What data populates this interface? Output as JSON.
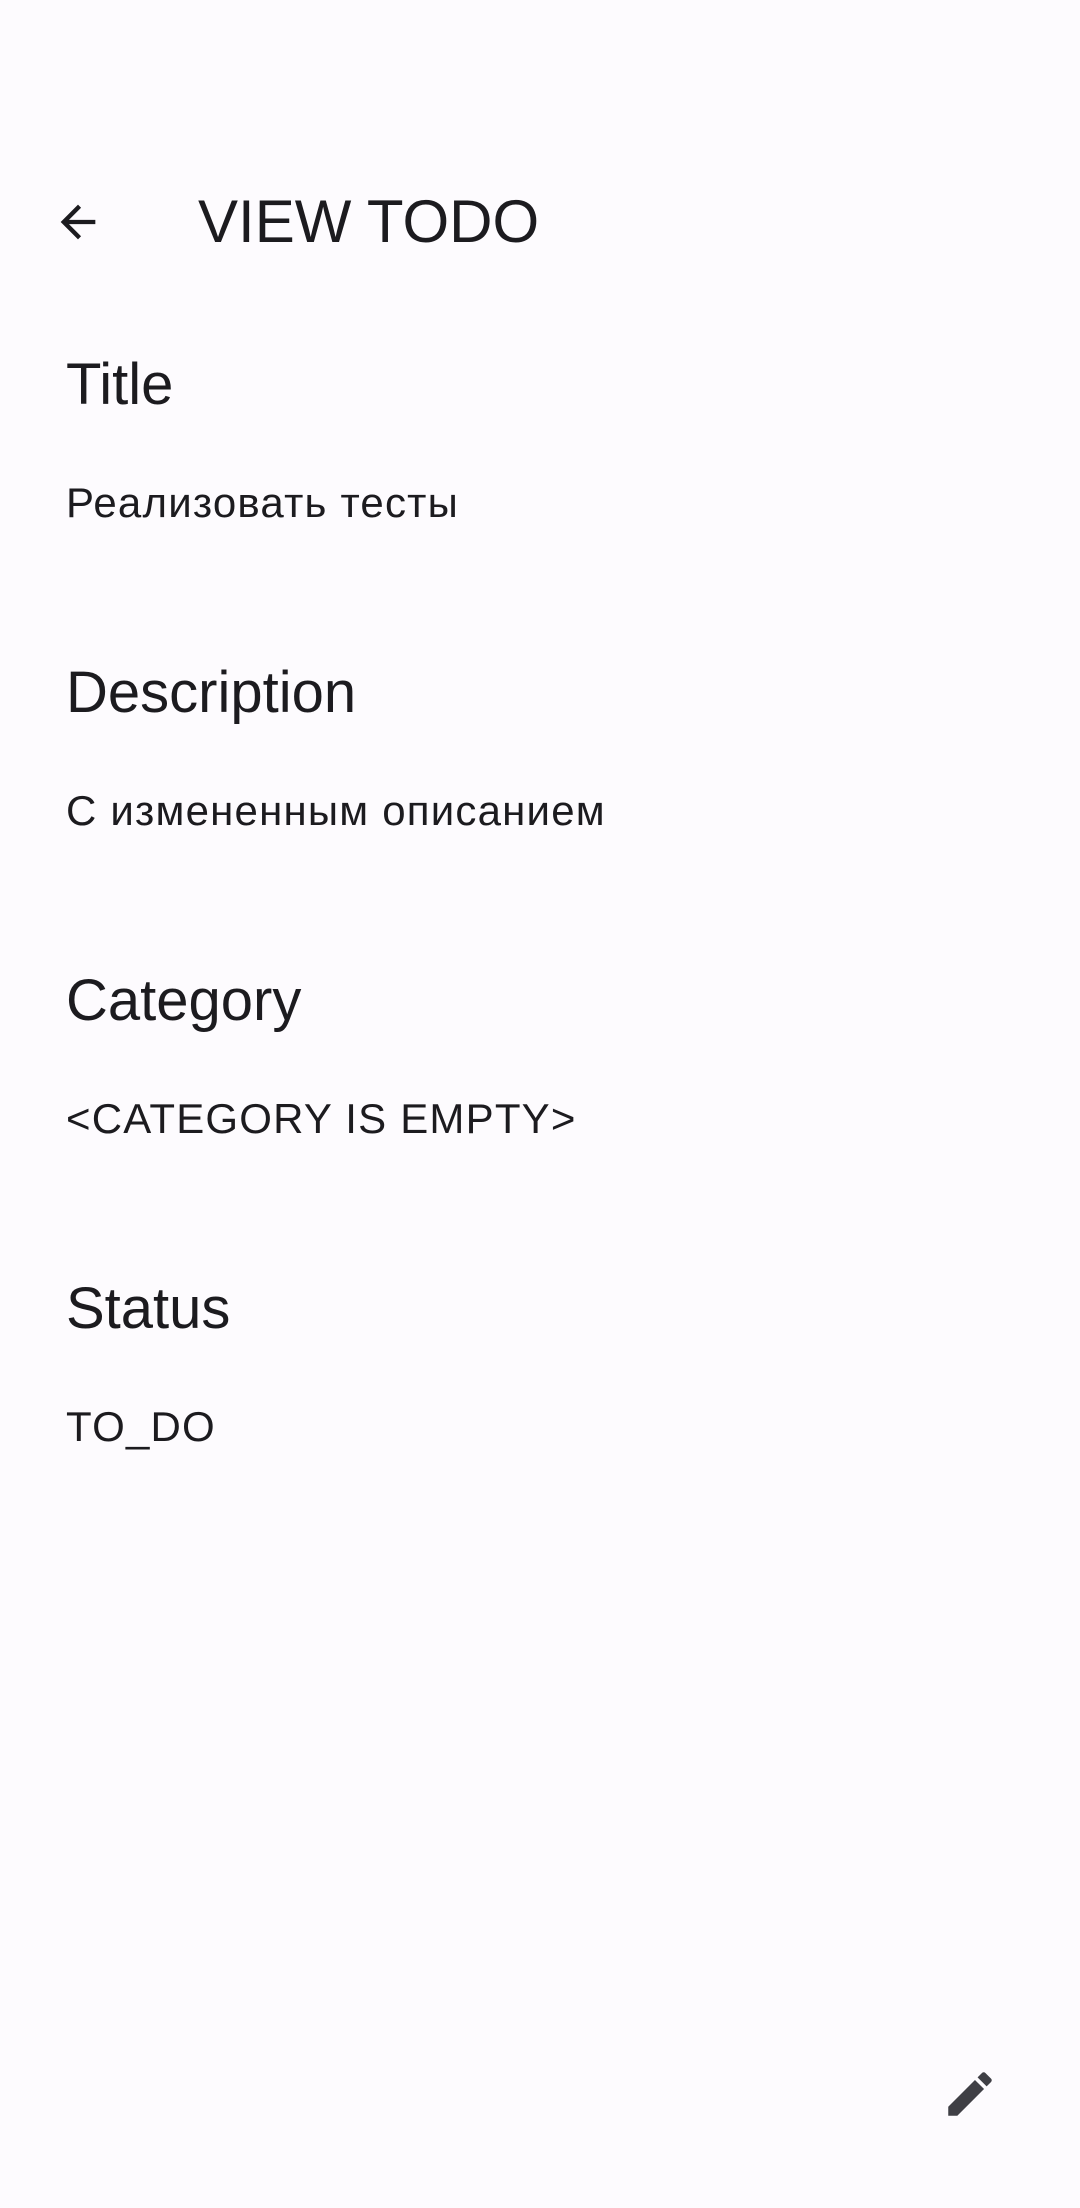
{
  "app_bar": {
    "title": "VIEW TODO",
    "back_icon": "arrow-back-icon"
  },
  "fields": [
    {
      "label": "Title",
      "value": "Реализовать тесты"
    },
    {
      "label": "Description",
      "value": "С измененным описанием"
    },
    {
      "label": "Category",
      "value": "<CATEGORY IS EMPTY>"
    },
    {
      "label": "Status",
      "value": "TO_DO"
    }
  ],
  "fab": {
    "icon": "edit-pencil-icon"
  },
  "colors": {
    "background": "#fdfbfe",
    "text": "#1c1b1f",
    "icon": "#3f3f45"
  }
}
